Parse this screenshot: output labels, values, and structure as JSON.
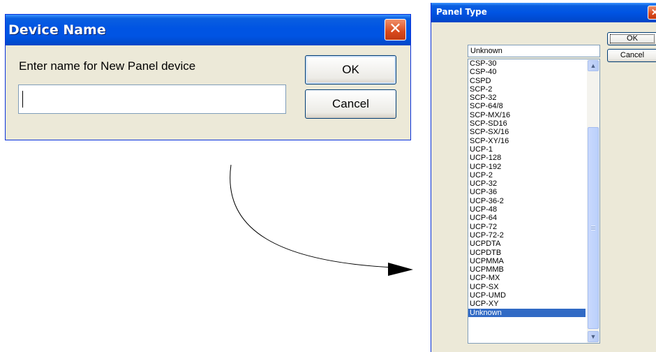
{
  "device_name_dialog": {
    "title": "Device Name",
    "close_glyph": "✕",
    "prompt": "Enter name for New Panel device",
    "input_value": "",
    "ok_label": "OK",
    "cancel_label": "Cancel"
  },
  "panel_type_dialog": {
    "title": "Panel Type",
    "close_glyph": "✕",
    "combo_value": "Unknown",
    "ok_label": "OK",
    "cancel_label": "Cancel",
    "selected_item": "Unknown",
    "items": [
      "CSP-30",
      "CSP-40",
      "CSPD",
      "SCP-2",
      "SCP-32",
      "SCP-64/8",
      "SCP-MX/16",
      "SCP-SD16",
      "SCP-SX/16",
      "SCP-XY/16",
      "UCP-1",
      "UCP-128",
      "UCP-192",
      "UCP-2",
      "UCP-32",
      "UCP-36",
      "UCP-36-2",
      "UCP-48",
      "UCP-64",
      "UCP-72",
      "UCP-72-2",
      "UCPDTA",
      "UCPDTB",
      "UCPMMA",
      "UCPMMB",
      "UCP-MX",
      "UCP-SX",
      "UCP-UMD",
      "UCP-XY",
      "Unknown"
    ]
  },
  "icons": {
    "arrow": "curved-arrow-icon",
    "scroll_up": "scroll-up-icon",
    "scroll_down": "scroll-down-icon"
  },
  "colors": {
    "titlebar": "#0054e3",
    "dialog_bg": "#ece9d8",
    "selection": "#316ac5",
    "close_button": "#d94a1c"
  }
}
